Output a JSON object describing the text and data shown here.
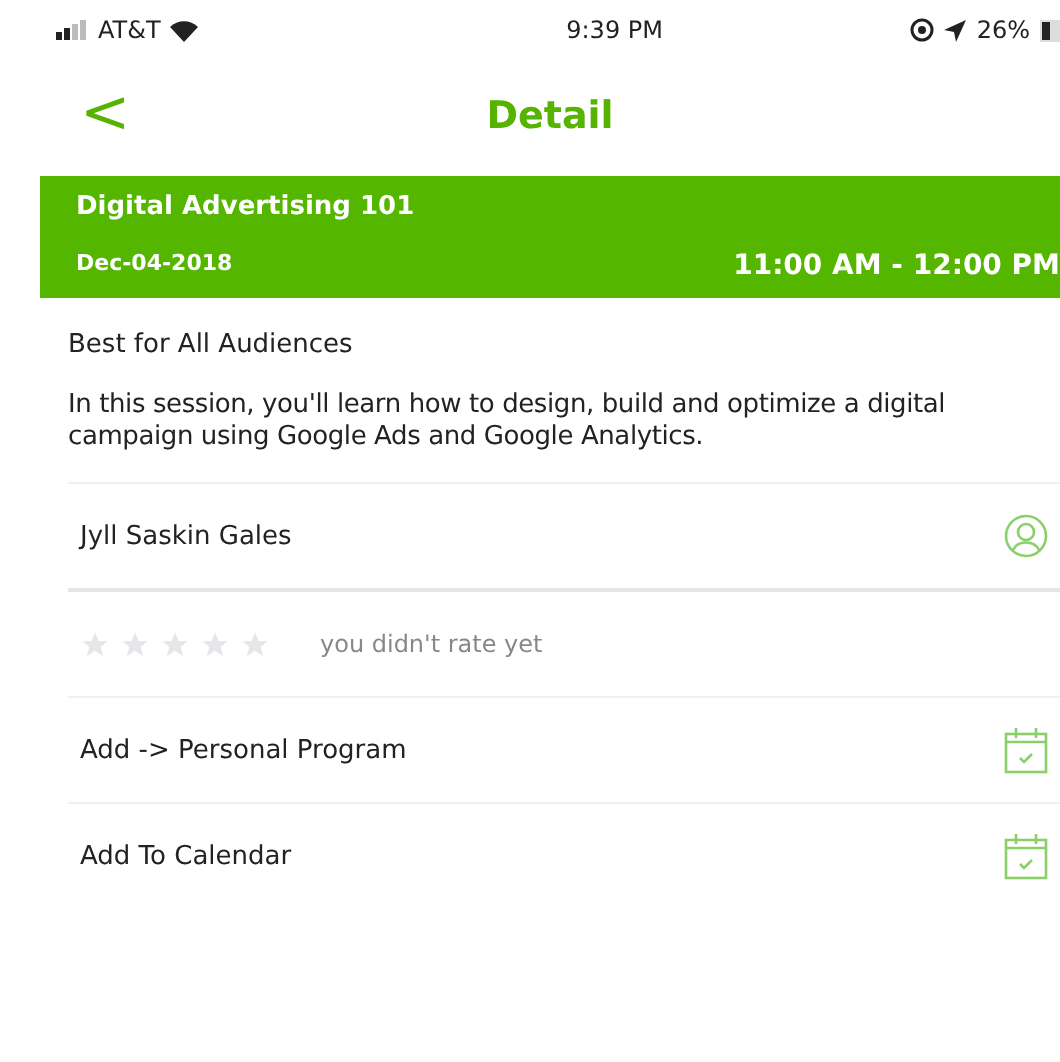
{
  "status_bar": {
    "carrier": "AT&T",
    "time": "9:39 PM",
    "battery": "26%"
  },
  "nav": {
    "back": "<",
    "title": "Detail"
  },
  "session": {
    "title": "Digital Advertising 101",
    "date": "Dec-04-2018",
    "time": "11:00 AM - 12:00 PM"
  },
  "audience": "Best for All Audiences",
  "description": "In this session, you'll learn how to design, build and optimize a digital campaign using Google Ads and Google Analytics.",
  "speaker": {
    "name": "Jyll Saskin Gales"
  },
  "rating": {
    "stars": 0,
    "note": "you didn't rate yet"
  },
  "actions": [
    {
      "label": "Add -> Personal Program"
    },
    {
      "label": "Add To Calendar"
    }
  ]
}
